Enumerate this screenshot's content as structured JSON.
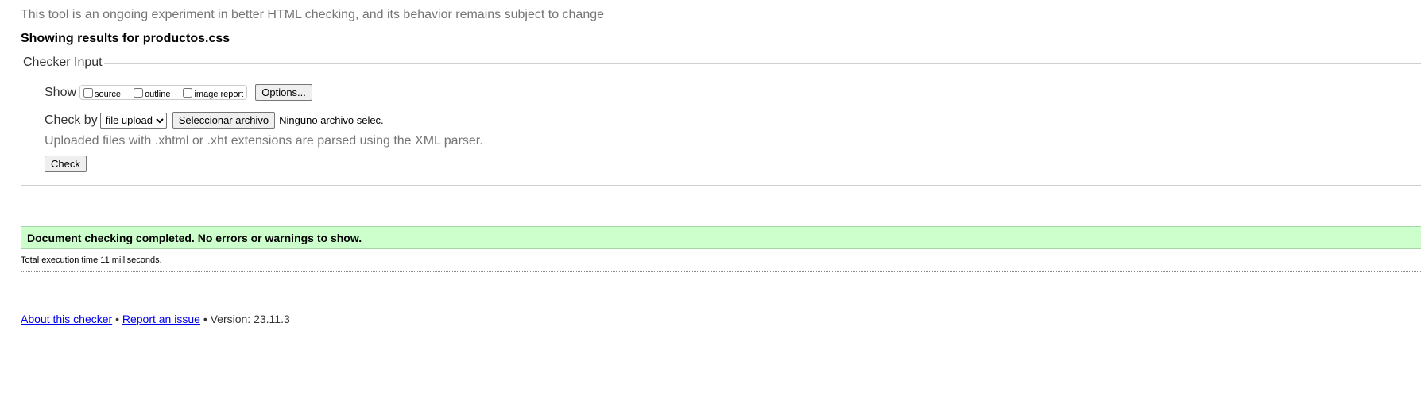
{
  "header": {
    "subtitle": "This tool is an ongoing experiment in better HTML checking, and its behavior remains subject to change",
    "results_heading": "Showing results for productos.css"
  },
  "checker_input": {
    "legend": "Checker Input",
    "show_label": "Show",
    "show_options": [
      {
        "label": "source",
        "checked": false
      },
      {
        "label": "outline",
        "checked": false
      },
      {
        "label": "image report",
        "checked": false
      }
    ],
    "options_button": "Options...",
    "check_by_label": "Check by",
    "check_by_selected": "file upload",
    "file_button": "Seleccionar archivo",
    "file_status": "Ninguno archivo selec.",
    "xml_note": "Uploaded files with .xhtml or .xht extensions are parsed using the XML parser.",
    "check_button": "Check"
  },
  "results": {
    "success_message": "Document checking completed. No errors or warnings to show.",
    "execution_time": "Total execution time 11 milliseconds."
  },
  "footer": {
    "about_link": "About this checker",
    "bullet_1": "•",
    "report_link": "Report an issue",
    "bullet_2": "•",
    "version": "Version: 23.11.3"
  },
  "colors": {
    "success_bg": "#ccffcc",
    "link": "#0000ee",
    "muted_text": "#757575"
  }
}
